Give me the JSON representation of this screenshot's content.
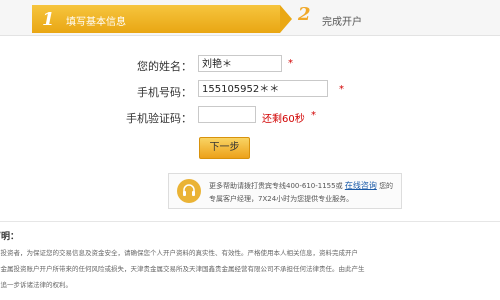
{
  "steps": [
    {
      "number": "1",
      "label": "填写基本信息"
    },
    {
      "number": "2",
      "label": "完成开户"
    }
  ],
  "form": {
    "name_label": "您的姓名：",
    "name_value": "刘艳＊",
    "phone_label": "手机号码：",
    "phone_value": "155105952＊＊",
    "code_label": "手机验证码：",
    "code_value": "",
    "required_mark": "*",
    "countdown": "还剩60秒",
    "next_button": "下一步"
  },
  "help": {
    "line1_prefix": "更多帮助请拨打贵宾专线400-610-1155或",
    "link": "在线咨询",
    "line1_suffix": "您的",
    "line2": "专属客户经理，7X24小时为您提供专业服务。"
  },
  "disclaimer": {
    "title": "声明：",
    "lines": [
      "的投资者，为保证您的交易信息及资金安全，请确保您个人开户资料的真实性、有效性。严格使用本人相关信息，资料完成开户",
      "贵金属投资账户开户所带来的任何风险或损失，天津贵金属交易所及天津国鑫贵金属经营有限公司不承担任何法律责任。由此产生",
      "留追一步诉诸法律的权利。"
    ]
  },
  "colors": {
    "step_active": "#eaa814",
    "required": "#d10000",
    "link": "#1a5aa8",
    "button": "#eca11a"
  }
}
